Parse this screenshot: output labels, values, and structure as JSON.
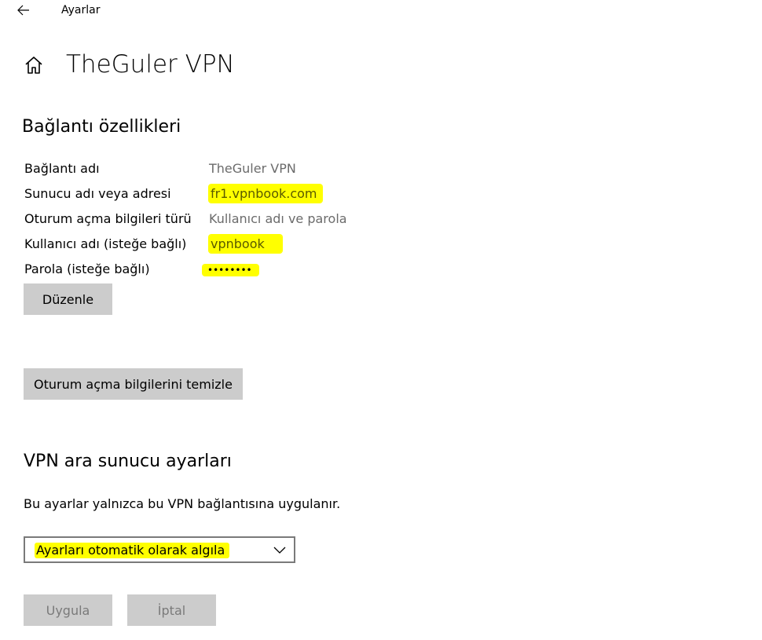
{
  "window": {
    "app_title": "Ayarlar"
  },
  "page": {
    "title": "TheGuler VPN"
  },
  "connection_properties": {
    "heading": "Bağlantı özellikleri",
    "rows": [
      {
        "label": "Bağlantı adı",
        "value": "TheGuler VPN"
      },
      {
        "label": "Sunucu adı veya adresi",
        "value": "fr1.vpnbook.com"
      },
      {
        "label": "Oturum açma bilgileri türü",
        "value": "Kullanıcı adı ve parola"
      },
      {
        "label": "Kullanıcı adı (isteğe bağlı)",
        "value": "vpnbook"
      },
      {
        "label": "Parola (isteğe bağlı)",
        "value": "••••••••"
      }
    ],
    "edit_button": "Düzenle",
    "clear_button": "Oturum açma bilgilerini temizle"
  },
  "proxy": {
    "heading": "VPN ara sunucu ayarları",
    "description": "Bu ayarlar yalnızca bu VPN bağlantısına uygulanır.",
    "dropdown_value": "Ayarları otomatik olarak algıla",
    "apply_button": "Uygula",
    "cancel_button": "İptal"
  },
  "colors": {
    "highlight": "#ffff00",
    "button_bg": "#cccccc",
    "value_text": "#6b6b6b"
  }
}
